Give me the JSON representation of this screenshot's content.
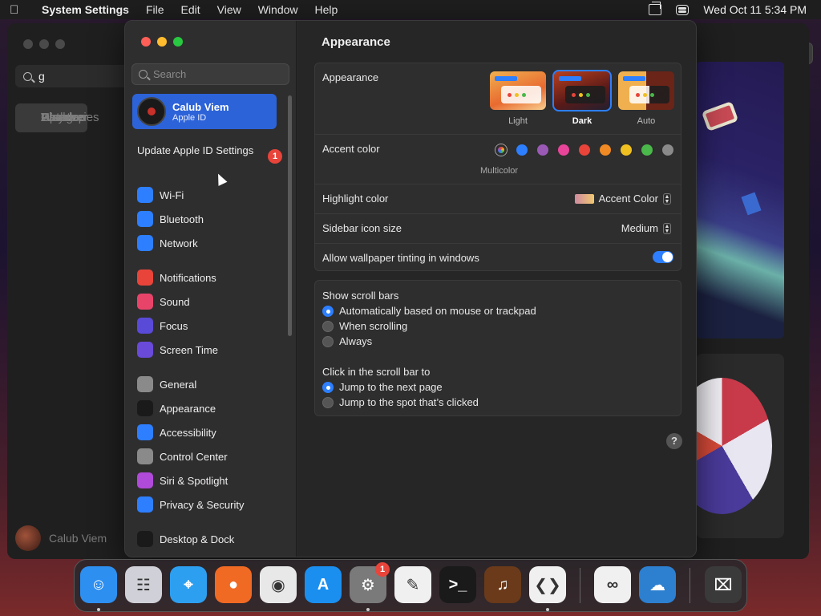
{
  "menubar": {
    "app_name": "System Settings",
    "items": [
      "File",
      "Edit",
      "View",
      "Window",
      "Help"
    ],
    "clock": "Wed Oct 11  5:34 PM"
  },
  "background_window": {
    "search_value": "g",
    "nav": [
      "Discover",
      "Arcade",
      "Create",
      "Work",
      "Play",
      "Develop",
      "Categories",
      "Updates"
    ],
    "user": "Calub Viem"
  },
  "sidebar": {
    "search_placeholder": "Search",
    "account": {
      "name": "Calub Viem",
      "sub": "Apple ID"
    },
    "update": {
      "label": "Update Apple ID Settings",
      "badge": "1"
    },
    "items": [
      {
        "label": "Wi-Fi",
        "icon": "wifi-icon",
        "color": "#2d7fff"
      },
      {
        "label": "Bluetooth",
        "icon": "bluetooth-icon",
        "color": "#2d7fff"
      },
      {
        "label": "Network",
        "icon": "globe-icon",
        "color": "#2d7fff"
      },
      {
        "label": "Notifications",
        "icon": "bell-icon",
        "color": "#e8443a"
      },
      {
        "label": "Sound",
        "icon": "speaker-icon",
        "color": "#e8446a"
      },
      {
        "label": "Focus",
        "icon": "moon-icon",
        "color": "#5a4ad8"
      },
      {
        "label": "Screen Time",
        "icon": "hourglass-icon",
        "color": "#6a4ad8"
      },
      {
        "label": "General",
        "icon": "gear-icon",
        "color": "#8a8a8a"
      },
      {
        "label": "Appearance",
        "icon": "appearance-icon",
        "color": "#1a1a1a"
      },
      {
        "label": "Accessibility",
        "icon": "accessibility-icon",
        "color": "#2d7fff"
      },
      {
        "label": "Control Center",
        "icon": "control-center-icon",
        "color": "#8a8a8a"
      },
      {
        "label": "Siri & Spotlight",
        "icon": "siri-icon",
        "color": "#b04ad8"
      },
      {
        "label": "Privacy & Security",
        "icon": "hand-icon",
        "color": "#2d7fff"
      },
      {
        "label": "Desktop & Dock",
        "icon": "dock-icon",
        "color": "#1a1a1a"
      }
    ]
  },
  "main": {
    "title": "Appearance",
    "appearance": {
      "label": "Appearance",
      "options": [
        "Light",
        "Dark",
        "Auto"
      ],
      "selected": "Dark"
    },
    "accent": {
      "label": "Accent color",
      "colors": [
        "#2d7fff",
        "#9b59b6",
        "#e8449a",
        "#e8443a",
        "#f08a24",
        "#f0c020",
        "#4ab84a",
        "#8a8a8a"
      ],
      "multicolor_label": "Multicolor"
    },
    "highlight": {
      "label": "Highlight color",
      "value": "Accent Color"
    },
    "icon_size": {
      "label": "Sidebar icon size",
      "value": "Medium"
    },
    "tinting": {
      "label": "Allow wallpaper tinting in windows",
      "enabled": true
    },
    "scroll_bars": {
      "label": "Show scroll bars",
      "options": [
        "Automatically based on mouse or trackpad",
        "When scrolling",
        "Always"
      ],
      "selected_index": 0
    },
    "click_scroll": {
      "label": "Click in the scroll bar to",
      "options": [
        "Jump to the next page",
        "Jump to the spot that’s clicked"
      ],
      "selected_index": 0
    },
    "help": "?"
  },
  "dock": {
    "apps": [
      {
        "name": "Finder",
        "icon": "finder-icon",
        "color": "#2d8ff0",
        "glyph": "☺"
      },
      {
        "name": "Launchpad",
        "icon": "launchpad-icon",
        "color": "#d0d0d8",
        "glyph": "☷"
      },
      {
        "name": "Safari",
        "icon": "safari-icon",
        "color": "#2d9ff0",
        "glyph": "⌖"
      },
      {
        "name": "Firefox",
        "icon": "firefox-icon",
        "color": "#f06a24",
        "glyph": "●"
      },
      {
        "name": "Chrome",
        "icon": "chrome-icon",
        "color": "#e8e8e8",
        "glyph": "◉"
      },
      {
        "name": "App Store",
        "icon": "app-store-icon",
        "color": "#1a8ff0",
        "glyph": "A"
      },
      {
        "name": "System Settings",
        "icon": "system-settings-icon",
        "color": "#7a7a7a",
        "glyph": "⚙",
        "badge": "1"
      },
      {
        "name": "TextEdit",
        "icon": "textedit-icon",
        "color": "#f0f0f0",
        "glyph": "✎"
      },
      {
        "name": "Terminal",
        "icon": "terminal-icon",
        "color": "#1a1a1a",
        "glyph": ">_"
      },
      {
        "name": "GarageBand",
        "icon": "garageband-icon",
        "color": "#6a3a1a",
        "glyph": "♫"
      },
      {
        "name": "VS Code",
        "icon": "vscode-icon",
        "color": "#f0f0f0",
        "glyph": "❮❯"
      },
      {
        "name": "Visual Studio",
        "icon": "visual-studio-icon",
        "color": "#f0f0f0",
        "glyph": "∞"
      },
      {
        "name": "Weather",
        "icon": "weather-icon",
        "color": "#2d7fd0",
        "glyph": "☁"
      },
      {
        "name": "Trash",
        "icon": "trash-icon",
        "color": "#3a3a3a",
        "glyph": "⌧"
      }
    ]
  }
}
